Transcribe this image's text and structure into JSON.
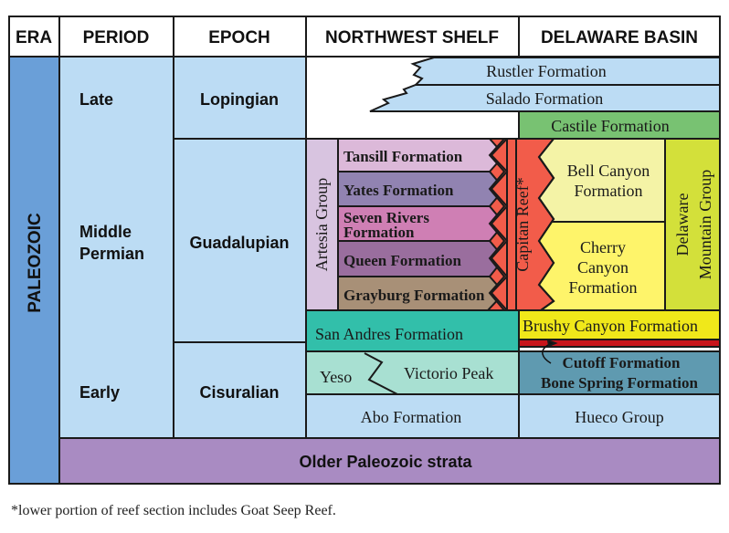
{
  "headers": {
    "era": "ERA",
    "period": "PERIOD",
    "epoch": "EPOCH",
    "northwest_shelf": "NORTHWEST SHELF",
    "delaware_basin": "DELAWARE BASIN"
  },
  "era": "PALEOZOIC",
  "periods": {
    "late": "Late",
    "middle_line1": "Middle",
    "middle_line2": "Permian",
    "early": "Early"
  },
  "epochs": {
    "lopingian": "Lopingian",
    "guadalupian": "Guadalupian",
    "cisuralian": "Cisuralian"
  },
  "northwest_shelf": {
    "artesia_group": "Artesia Group",
    "tansill": "Tansill Formation",
    "yates": "Yates Formation",
    "seven_rivers_line1": "Seven Rivers",
    "seven_rivers_line2": "Formation",
    "queen": "Queen Formation",
    "grayburg": "Grayburg Formation",
    "san_andres": "San Andres Formation",
    "yeso": "Yeso",
    "victorio_peak": "Victorio Peak",
    "abo": "Abo Formation"
  },
  "shared": {
    "rustler": "Rustler Formation",
    "salado": "Salado Formation",
    "capitan_reef": "Capitan Reef*",
    "older": "Older Paleozoic strata"
  },
  "delaware_basin": {
    "castile": "Castile Formation",
    "bell_canyon_line1": "Bell Canyon",
    "bell_canyon_line2": "Formation",
    "cherry_canyon_line1": "Cherry",
    "cherry_canyon_line2": "Canyon",
    "cherry_canyon_line3": "Formation",
    "delaware_mountain_line1": "Delaware",
    "delaware_mountain_line2": "Mountain Group",
    "brushy_canyon": "Brushy Canyon Formation",
    "cutoff": "Cutoff Formation",
    "bone_spring": "Bone Spring Formation",
    "hueco": "Hueco Group"
  },
  "footnote": "*lower portion of reef section includes Goat Seep Reef.",
  "colors": {
    "era": "#6a9fd8",
    "light_blue": "#bcdcf4",
    "castile": "#78c272",
    "artesia": "#d8c4e0",
    "tansill": "#dcb9d9",
    "yates": "#9183b1",
    "seven_rivers": "#cf7fb4",
    "queen": "#9a6e9e",
    "grayburg": "#a89077",
    "reef": "#f25c4a",
    "bell_canyon": "#f4f3a6",
    "cherry_canyon": "#fef46a",
    "delaware_mountain": "#d3e03a",
    "san_andres": "#32bfaa",
    "brushy_canyon": "#f0e81a",
    "cutoff": "#c8151b",
    "bone_spring": "#5f9ab0",
    "yeso_victorio": "#a8e0d2",
    "older": "#a98bc2"
  }
}
